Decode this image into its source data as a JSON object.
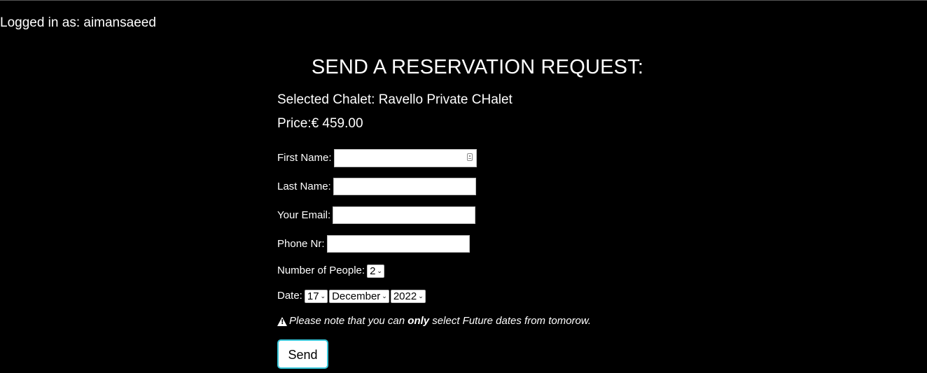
{
  "header": {
    "logged_in_text": "Logged in as: aimansaeed"
  },
  "form": {
    "title": "SEND A RESERVATION REQUEST:",
    "selected_chalet": "Selected Chalet: Ravello Private CHalet",
    "price": "Price:€ 459.00",
    "fields": {
      "first_name_label": "First Name:",
      "first_name_value": "",
      "last_name_label": "Last Name:",
      "last_name_value": "",
      "email_label": "Your Email:",
      "email_value": "",
      "phone_label": "Phone Nr:",
      "phone_value": ""
    },
    "people": {
      "label": "Number of People:",
      "selected": "2"
    },
    "date": {
      "label": "Date:",
      "day": "17",
      "month": "December",
      "year": "2022"
    },
    "note": {
      "icon": "warning-icon",
      "prefix": "Please note that you can ",
      "emphasis": "only",
      "suffix": " select Future dates from tomorow."
    },
    "send_label": "Send"
  },
  "colors": {
    "background": "#000000",
    "text": "#ffffff",
    "button_border": "#39c7d9"
  }
}
